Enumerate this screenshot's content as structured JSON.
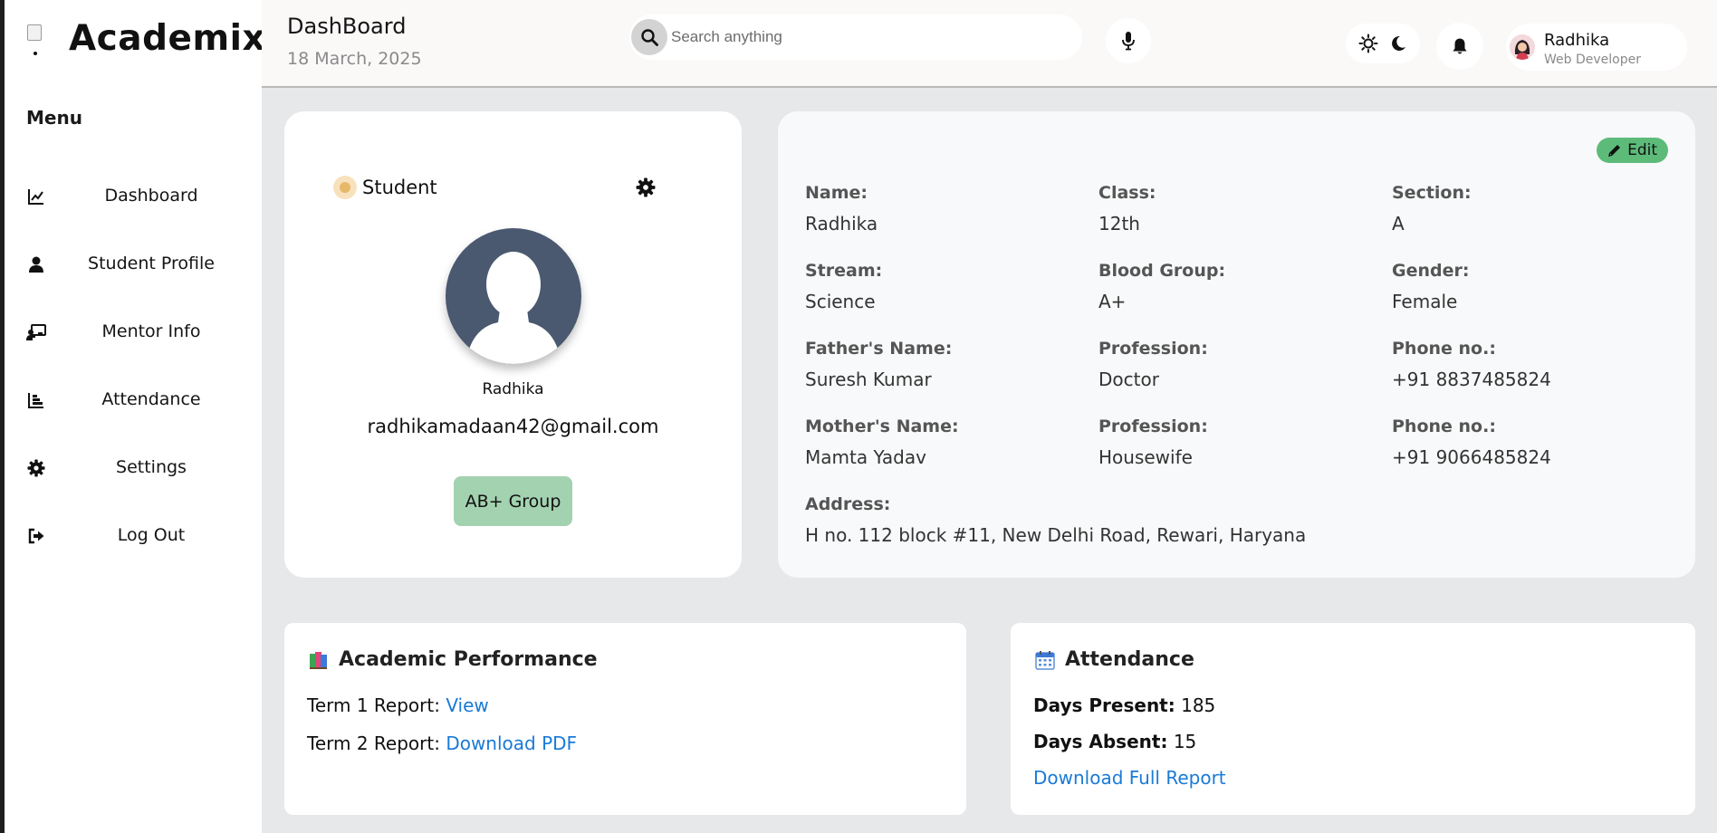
{
  "brand": {
    "name": "Academix"
  },
  "sidebar": {
    "menu_title": "Menu",
    "items": [
      {
        "label": "Dashboard",
        "icon": "chart-line-icon"
      },
      {
        "label": "Student Profile",
        "icon": "user-icon"
      },
      {
        "label": "Mentor Info",
        "icon": "chalkboard-teacher-icon"
      },
      {
        "label": "Attendance",
        "icon": "bar-chart-icon"
      },
      {
        "label": "Settings",
        "icon": "gear-icon"
      },
      {
        "label": "Log Out",
        "icon": "logout-icon"
      }
    ]
  },
  "header": {
    "title": "DashBoard",
    "date": "18 March, 2025",
    "search_placeholder": "Search anything",
    "user": {
      "name": "Radhika",
      "role": "Web Developer"
    }
  },
  "profile": {
    "role": "Student",
    "name": "Radhika",
    "email": "radhikamadaan42@gmail.com",
    "group": "AB+ Group"
  },
  "info": {
    "edit_label": "Edit",
    "fields": [
      {
        "label": "Name:",
        "value": "Radhika"
      },
      {
        "label": "Class:",
        "value": "12th"
      },
      {
        "label": "Section:",
        "value": "A"
      },
      {
        "label": "Stream:",
        "value": "Science"
      },
      {
        "label": "Blood Group:",
        "value": "A+"
      },
      {
        "label": "Gender:",
        "value": "Female"
      },
      {
        "label": "Father's Name:",
        "value": "Suresh Kumar"
      },
      {
        "label": "Profession:",
        "value": "Doctor"
      },
      {
        "label": "Phone no.:",
        "value": "+91 8837485824"
      },
      {
        "label": "Mother's Name:",
        "value": "Mamta Yadav"
      },
      {
        "label": "Profession:",
        "value": "Housewife"
      },
      {
        "label": "Phone no.:",
        "value": "+91 9066485824"
      },
      {
        "label": "Address:",
        "value": "H no. 112 block #11, New Delhi Road, Rewari, Haryana"
      }
    ]
  },
  "performance": {
    "title": "Academic Performance",
    "term1_label": "Term 1 Report:",
    "term1_link": "View",
    "term2_label": "Term 2 Report:",
    "term2_link": "Download PDF"
  },
  "attendance": {
    "title": "Attendance",
    "present_label": "Days Present:",
    "present_value": "185",
    "absent_label": "Days Absent:",
    "absent_value": "15",
    "report_link": "Download Full Report"
  }
}
